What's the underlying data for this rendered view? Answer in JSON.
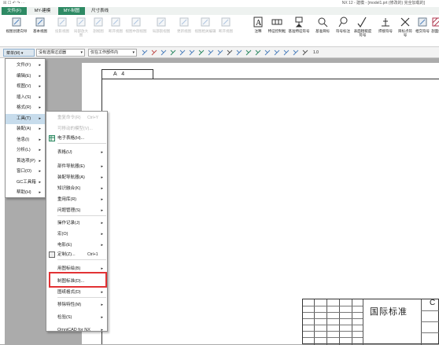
{
  "titlebar": {
    "left": "☒ ☐ ↶ ↷ ⋯",
    "right": "NX 12 - 建模 - [model1.prt (修改的) 完全加载的]"
  },
  "tabs": [
    {
      "label": "文件(F)"
    },
    {
      "label": "MY-建模"
    },
    {
      "label": "MY-制图"
    },
    {
      "label": "尺寸表线"
    }
  ],
  "ribbon": {
    "items": [
      {
        "label": "视图创建向导",
        "icon": "view-wizard-icon",
        "dim": false
      },
      {
        "label": "基本视图",
        "icon": "base-view-icon",
        "dim": false
      },
      {
        "label": "投影视图",
        "icon": "projected-view-icon",
        "dim": true
      },
      {
        "label": "局部放大图",
        "icon": "detail-view-icon",
        "dim": true
      },
      {
        "label": "剖视图",
        "icon": "section-view-icon",
        "dim": true
      },
      {
        "label": "断开视图",
        "icon": "break-view-icon",
        "dim": true
      },
      {
        "label": "视图中剖视图",
        "icon": "inline-section-icon",
        "dim": true
      },
      {
        "label": "局部剖视图",
        "icon": "break-out-section-icon",
        "dim": true
      },
      {
        "label": "更新视图",
        "icon": "update-view-icon",
        "dim": true
      },
      {
        "label": "视图相关编辑",
        "icon": "view-edit-icon",
        "dim": true
      },
      {
        "label": "断开视图",
        "icon": "break-icon",
        "dim": true
      },
      {
        "label": "注释",
        "icon": "note-icon",
        "dim": false
      },
      {
        "label": "特征控制框",
        "icon": "feature-control-icon",
        "dim": false
      },
      {
        "label": "基准特征符号",
        "icon": "datum-feature-icon",
        "dim": false
      },
      {
        "label": "基准目标",
        "icon": "datum-target-icon",
        "dim": false
      },
      {
        "label": "符号标注",
        "icon": "balloon-icon",
        "dim": false
      },
      {
        "label": "表面粗糙度符号",
        "icon": "surface-finish-icon",
        "dim": false
      },
      {
        "label": "焊接符号",
        "icon": "weld-symbol-icon",
        "dim": false
      },
      {
        "label": "目标点符号",
        "icon": "target-point-icon",
        "dim": false
      },
      {
        "label": "相交符号",
        "icon": "intersection-icon",
        "dim": false
      },
      {
        "label": "剖面线",
        "icon": "hatch-icon",
        "dim": false
      }
    ]
  },
  "toolbar": {
    "menu_button": "菜单(M)",
    "filter_combo": "没有选择过滤器",
    "scope_combo": "仅在工作部件内",
    "zoom": "1.0"
  },
  "main_menu": {
    "items": [
      {
        "label": "文件(F)"
      },
      {
        "label": "编辑(E)"
      },
      {
        "label": "视图(V)"
      },
      {
        "label": "插入(S)"
      },
      {
        "label": "格式(R)"
      },
      {
        "label": "工具(T)"
      },
      {
        "label": "装配(A)"
      },
      {
        "label": "信息(I)"
      },
      {
        "label": "分析(L)"
      },
      {
        "label": "首选项(P)"
      },
      {
        "label": "窗口(O)"
      },
      {
        "label": "GC工具箱"
      },
      {
        "label": "帮助(H)"
      }
    ]
  },
  "tools_menu": {
    "items": [
      {
        "label": "重复命令(R)",
        "shortcut": "Ctrl+Y",
        "dim": true,
        "sub": false
      },
      {
        "label": "可移动的模型(V)...",
        "shortcut": "",
        "dim": true,
        "sub": false
      },
      {
        "label": "电子表格(H)...",
        "shortcut": "",
        "dim": false,
        "sub": false
      },
      {
        "label": "表格(U)",
        "shortcut": "",
        "dim": false,
        "sub": true
      },
      {
        "label": "部件导航器(E)",
        "shortcut": "",
        "dim": false,
        "sub": true
      },
      {
        "label": "装配导航器(A)",
        "shortcut": "",
        "dim": false,
        "sub": true
      },
      {
        "label": "知识融合(K)",
        "shortcut": "",
        "dim": false,
        "sub": true
      },
      {
        "label": "重用库(R)",
        "shortcut": "",
        "dim": false,
        "sub": true
      },
      {
        "label": "问题管理(S)",
        "shortcut": "",
        "dim": false,
        "sub": true
      },
      {
        "label": "操作记录(J)",
        "shortcut": "",
        "dim": false,
        "sub": true
      },
      {
        "label": "宏(O)",
        "shortcut": "",
        "dim": false,
        "sub": true
      },
      {
        "label": "电影(E)",
        "shortcut": "",
        "dim": false,
        "sub": true
      },
      {
        "label": "定制(Z)...",
        "shortcut": "Ctrl+1",
        "dim": false,
        "sub": false
      },
      {
        "label": "用图标绘(B)",
        "shortcut": "",
        "dim": false,
        "sub": true
      },
      {
        "label": "制图标准(D)...",
        "shortcut": "",
        "dim": false,
        "sub": false
      },
      {
        "label": "图纸格式(D)",
        "shortcut": "",
        "dim": false,
        "sub": true
      },
      {
        "label": "移除特性(M)",
        "shortcut": "",
        "dim": false,
        "sub": true
      },
      {
        "label": "检验(S)",
        "shortcut": "",
        "dim": false,
        "sub": true
      },
      {
        "label": "OmniCAD for NX",
        "shortcut": "",
        "dim": false,
        "sub": true
      }
    ]
  },
  "sheet": {
    "label": "A 4"
  },
  "title_block": {
    "standard": "国际标准",
    "corner": "C"
  },
  "colors": {
    "accent": "#2e8a64",
    "highlight": "#e23234",
    "background": "#ababab"
  }
}
